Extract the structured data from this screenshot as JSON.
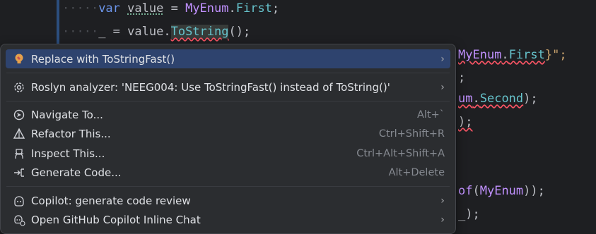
{
  "code": {
    "line1": {
      "keyword": "var",
      "name": "value",
      "equals": " = ",
      "enum": "MyEnum",
      "dot": ".",
      "member": "First",
      "end": ";"
    },
    "line2": {
      "discard": "_",
      "equals": " = ",
      "obj": "value",
      "dot": ".",
      "method": "ToString",
      "end": "();"
    },
    "line3": {
      "enum": "MyEnum",
      "dot": ".",
      "member": "First",
      "end": "}\";"
    },
    "line4": {
      "text": ";"
    },
    "line5": {
      "prefix": "um",
      "dot": ".",
      "member": "Second",
      "end": ");"
    },
    "line6": {
      "text": ");"
    },
    "line7": {
      "prefix": "of",
      "open": "(",
      "enum": "MyEnum",
      "end": "));"
    },
    "line8": {
      "text": "_);"
    }
  },
  "menu": {
    "items": [
      {
        "label": "Replace with ToStringFast()",
        "icon": "bulb-fix-icon",
        "shortcut": "",
        "submenu": true,
        "selected": true
      },
      {
        "label": "Roslyn analyzer: 'NEEG004: Use ToStringFast() instead of ToString()'",
        "icon": "gear-icon",
        "shortcut": "",
        "submenu": true
      },
      {
        "label": "Navigate To...",
        "icon": "navigate-icon",
        "shortcut": "Alt+`",
        "submenu": false
      },
      {
        "label": "Refactor This...",
        "icon": "refactor-icon",
        "shortcut": "Ctrl+Shift+R",
        "submenu": false
      },
      {
        "label": "Inspect This...",
        "icon": "inspect-icon",
        "shortcut": "Ctrl+Alt+Shift+A",
        "submenu": false
      },
      {
        "label": "Generate Code...",
        "icon": "generate-icon",
        "shortcut": "Alt+Delete",
        "submenu": false
      },
      {
        "label": "Copilot: generate code review",
        "icon": "copilot-icon",
        "shortcut": "",
        "submenu": true
      },
      {
        "label": "Open GitHub Copilot Inline Chat",
        "icon": "copilot-chat-icon",
        "shortcut": "",
        "submenu": true
      }
    ]
  },
  "colors": {
    "accent_selection": "#2e436e",
    "menu_bg": "#2b2d30",
    "editor_bg": "#1e1f22"
  }
}
